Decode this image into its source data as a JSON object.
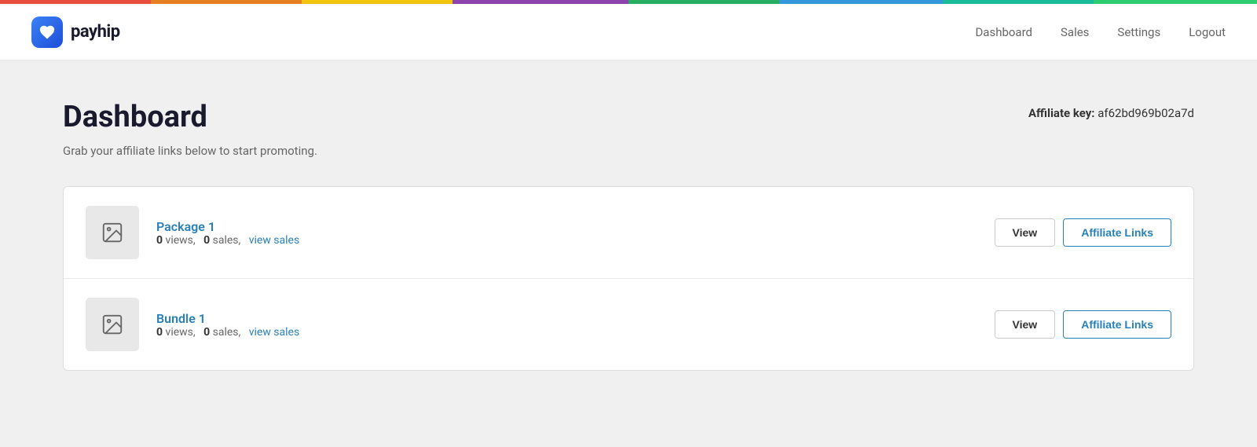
{
  "rainbow_bar": {},
  "header": {
    "logo_text": "payhip",
    "nav": {
      "dashboard_label": "Dashboard",
      "sales_label": "Sales",
      "settings_label": "Settings",
      "logout_label": "Logout"
    }
  },
  "main": {
    "page_title": "Dashboard",
    "page_subtitle": "Grab your affiliate links below to start promoting.",
    "affiliate_key_label": "Affiliate key:",
    "affiliate_key_value": "af62bd969b02a7d",
    "products": [
      {
        "id": "package-1",
        "name": "Package 1",
        "views": "0",
        "sales": "0",
        "views_label": "views,",
        "sales_label": "sales,",
        "view_sales_text": "view sales",
        "view_button_label": "View",
        "affiliate_links_label": "Affiliate Links"
      },
      {
        "id": "bundle-1",
        "name": "Bundle 1",
        "views": "0",
        "sales": "0",
        "views_label": "views,",
        "sales_label": "sales,",
        "view_sales_text": "view sales",
        "view_button_label": "View",
        "affiliate_links_label": "Affiliate Links"
      }
    ]
  }
}
